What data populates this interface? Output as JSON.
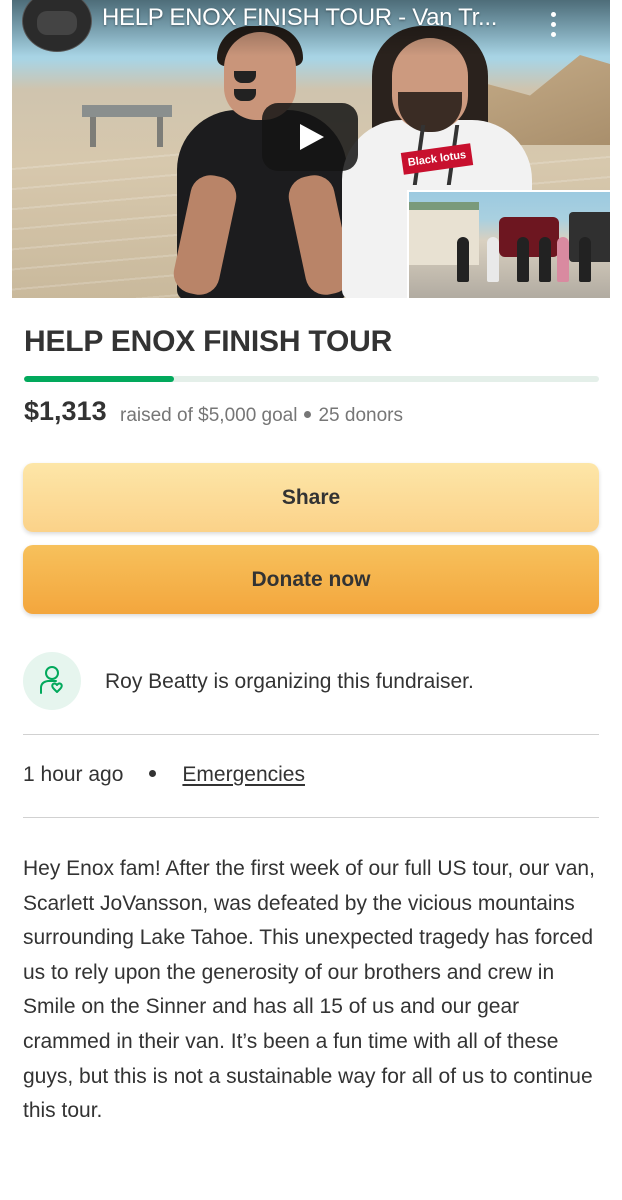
{
  "video": {
    "title": "HELP ENOX FINISH TOUR - Van Tr...",
    "shirt_text": "Black lotus"
  },
  "campaign": {
    "title": "HELP ENOX FINISH TOUR",
    "raised": "$1,313",
    "goal_text": "raised of $5,000 goal",
    "donors_text": "25 donors",
    "progress_fraction": 0.26
  },
  "buttons": {
    "share_label": "Share",
    "donate_label": "Donate now"
  },
  "organizer": {
    "text": "Roy Beatty is organizing this fundraiser.",
    "icon": "organizer-heart-icon"
  },
  "meta": {
    "time": "1 hour ago",
    "category": "Emergencies"
  },
  "story": "Hey Enox fam! After the first week of our full US tour, our van, Scarlett JoVansson, was defeated by the vicious mountains surrounding Lake Tahoe. This unexpected tragedy has forced us to rely upon the generosity of our brothers and crew in Smile on the Sinner and has all 15 of us and our gear crammed in their van. It’s been a fun time with all of these guys, but this is not a sustainable way for all of us to continue this tour.",
  "colors": {
    "progress": "#02a95c",
    "share_button": "#fbd289",
    "donate_button": "#f3a63d",
    "text": "#333333",
    "muted": "#767676"
  }
}
